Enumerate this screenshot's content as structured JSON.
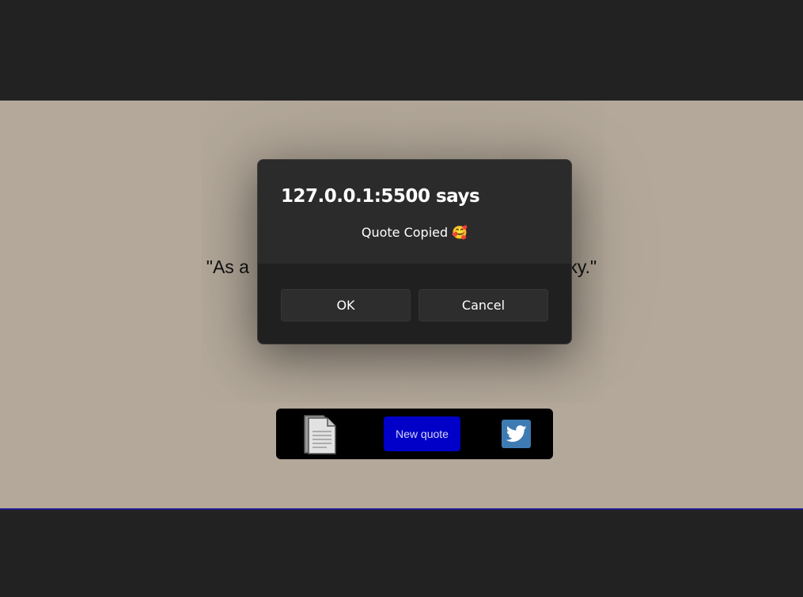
{
  "page": {
    "quote_visible_left": "\"As a",
    "quote_visible_right": "nisky.\""
  },
  "toolbar": {
    "copy_icon": "document-copy-icon",
    "new_quote_label": "New quote",
    "twitter_icon": "twitter-bird-icon"
  },
  "dialog": {
    "title": "127.0.0.1:5500 says",
    "message": "Quote Copied 🥰",
    "ok_label": "OK",
    "cancel_label": "Cancel"
  },
  "colors": {
    "page_background": "#b3a89a",
    "dark_band": "#222222",
    "new_quote_button": "#0000c8",
    "twitter_button": "#3f7bb3",
    "dialog_background": "#202020"
  }
}
